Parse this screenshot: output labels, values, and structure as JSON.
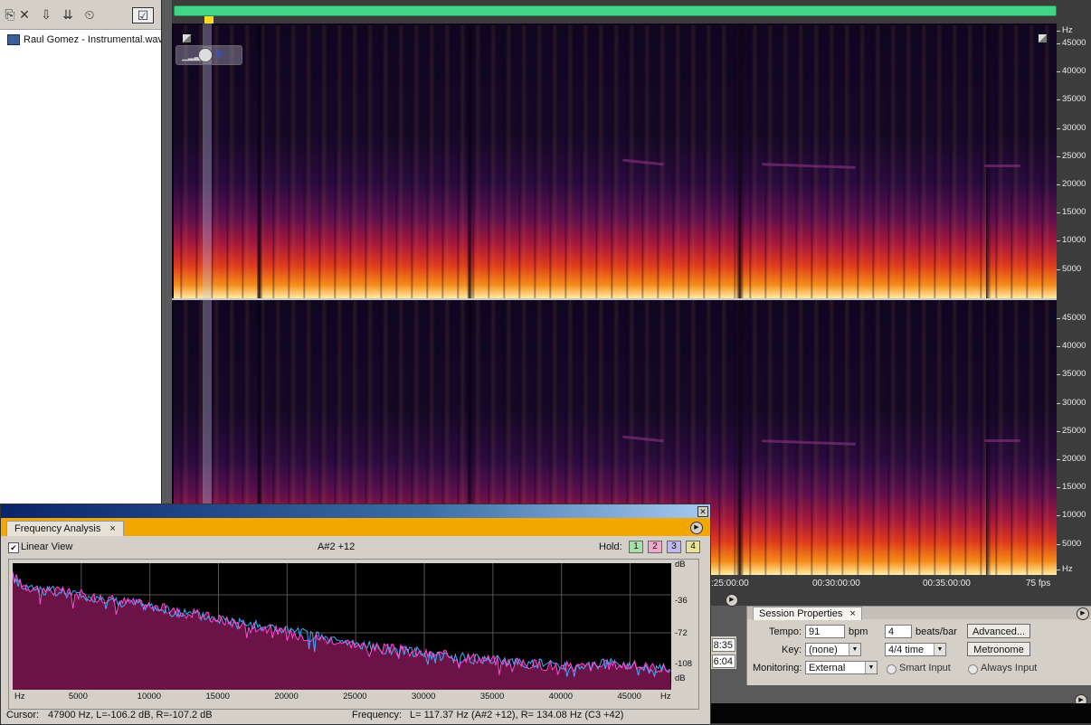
{
  "app": {
    "file_name": "Raul Gomez - Instrumental.wav"
  },
  "toolbar": {
    "icons": [
      "import-icon",
      "close-file-icon",
      "insert-icon",
      "insert-multitrack-icon",
      "metronome-icon",
      "view-toggle-icon"
    ]
  },
  "channel_display": {
    "volume_value": "0"
  },
  "frequency_ruler": {
    "unit": "Hz",
    "ticks": [
      "45000",
      "40000",
      "35000",
      "30000",
      "25000",
      "20000",
      "15000",
      "10000",
      "5000"
    ],
    "bottom_unit": "Hz"
  },
  "time_ruler": {
    "ticks": [
      ":25:00:00",
      "00:30:00:00",
      "00:35:00:00"
    ],
    "fps": "75 fps"
  },
  "colors": {
    "overview_bar": "#44d488",
    "playhead_marker": "#ffd92a",
    "spectral_hot": "#f58a18",
    "fa_tab_bar": "#f2a800",
    "series_left": "#ff4ad8",
    "series_right": "#3ab0ff",
    "fill": "#6b1346"
  },
  "transport_times": {
    "t1": "8:35",
    "t2": "6:04"
  },
  "session_properties": {
    "tab_label": "Session Properties",
    "close_glyph": "×",
    "tempo_label": "Tempo:",
    "tempo_value": "91",
    "bpm_label": "bpm",
    "beats_value": "4",
    "beats_label": "beats/bar",
    "advanced_button": "Advanced...",
    "key_label": "Key:",
    "key_value": "(none)",
    "time_sig_value": "4/4 time",
    "metronome_button": "Metronome",
    "monitoring_label": "Monitoring:",
    "monitoring_value": "External",
    "smart_input": "Smart Input",
    "always_input": "Always Input"
  },
  "frequency_analysis": {
    "tab_label": "Frequency Analysis",
    "close_glyph": "×",
    "linear_view_label": "Linear View",
    "linear_view_checked": true,
    "note_display": "A#2 +12",
    "hold_label": "Hold:",
    "hold_buttons": [
      "1",
      "2",
      "3",
      "4"
    ],
    "hold_colors": [
      "#a6e0a6",
      "#f0a8c8",
      "#c0b8f0",
      "#e8e29a"
    ],
    "db_labels": [
      "dB",
      "-36",
      "-72",
      "-108",
      "dB"
    ],
    "hz_labels": [
      "Hz",
      "5000",
      "10000",
      "15000",
      "20000",
      "25000",
      "30000",
      "35000",
      "40000",
      "45000",
      "Hz"
    ],
    "cursor_label": "Cursor:",
    "cursor_value": "47900 Hz, L=-106.2 dB, R=-107.2 dB",
    "frequency_label": "Frequency:",
    "frequency_value": "L= 117.37 Hz (A#2 +12), R= 134.08 Hz (C3 +42)"
  },
  "chart_data": {
    "type": "area",
    "x": [
      0,
      1000,
      2000,
      3000,
      4000,
      5000,
      6000,
      7000,
      8000,
      9000,
      10000,
      12000,
      14000,
      16000,
      18000,
      20000,
      22000,
      24000,
      26000,
      28000,
      30000,
      32000,
      34000,
      36000,
      38000,
      40000,
      42000,
      44000,
      46000,
      47900
    ],
    "series": [
      {
        "name": "L",
        "values": [
          -18,
          -28,
          -30,
          -32,
          -34,
          -36,
          -38,
          -40,
          -42,
          -44,
          -46,
          -52,
          -56,
          -62,
          -66,
          -72,
          -76,
          -80,
          -86,
          -88,
          -92,
          -94,
          -96,
          -100,
          -102,
          -104,
          -104,
          -102,
          -104,
          -106.2
        ]
      },
      {
        "name": "R",
        "values": [
          -20,
          -29,
          -31,
          -33,
          -35,
          -37,
          -39,
          -41,
          -43,
          -45,
          -47,
          -53,
          -57,
          -61,
          -65,
          -70,
          -75,
          -81,
          -85,
          -89,
          -91,
          -95,
          -97,
          -99,
          -101,
          -103,
          -103,
          -101,
          -105,
          -107.2
        ]
      }
    ],
    "xlabel": "Hz",
    "ylabel": "dB",
    "xlim": [
      0,
      48000
    ],
    "ylim": [
      -126,
      -6
    ],
    "grid": true
  }
}
